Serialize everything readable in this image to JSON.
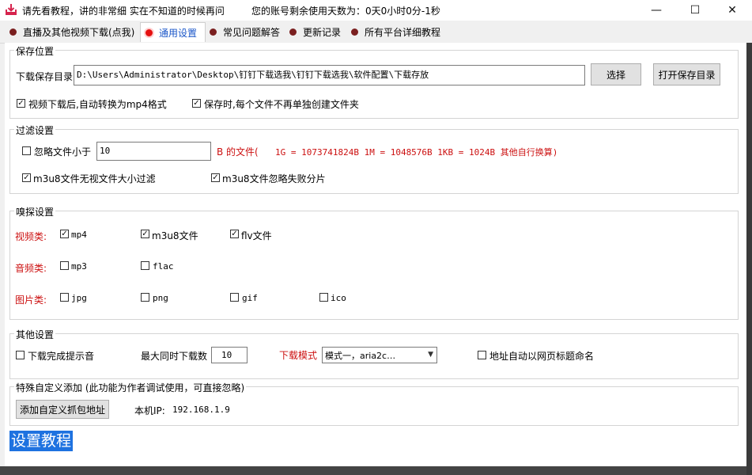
{
  "title": {
    "text": "请先看教程，讲的非常细  实在不知道的时候再问",
    "days_text": "您的账号剩余使用天数为：0天0小时0分-1秒"
  },
  "window_controls": {
    "minimize": "—",
    "maximize": "☐",
    "close": "✕"
  },
  "tabs": [
    {
      "label": "直播及其他视频下载(点我)",
      "active": false
    },
    {
      "label": "通用设置",
      "active": true
    },
    {
      "label": "常见问题解答",
      "active": false
    },
    {
      "label": "更新记录",
      "active": false
    },
    {
      "label": "所有平台详细教程",
      "active": false
    }
  ],
  "save": {
    "group_label": "保存位置",
    "dir_label": "下载保存目录",
    "dir_value": "D:\\Users\\Administrator\\Desktop\\钉钉下载选我\\钉钉下载选我\\软件配置\\下载存放",
    "choose_button": "选择",
    "open_button": "打开保存目录",
    "convert_mp4": {
      "label": "视频下载后,自动转换为mp4格式",
      "checked": true
    },
    "no_folder": {
      "label": "保存时,每个文件不再单独创建文件夹",
      "checked": true
    }
  },
  "filter": {
    "group_label": "过滤设置",
    "ignore_small": {
      "label": "忽略文件小于",
      "checked": false
    },
    "size_value": "10",
    "unit_text": "B 的文件(",
    "conversion_text": "1G = 1073741824B    1M = 1048576B  1KB = 1024B   其他自行换算)",
    "m3u8_no_size": {
      "label": "m3u8文件无视文件大小过滤",
      "checked": true
    },
    "m3u8_ignore_fail": {
      "label": "m3u8文件忽略失败分片",
      "checked": true
    }
  },
  "sniff": {
    "group_label": "嗅探设置",
    "video": {
      "label": "视频类:",
      "items": [
        {
          "label": "mp4",
          "checked": true
        },
        {
          "label": "m3u8文件",
          "checked": true
        },
        {
          "label": "flv文件",
          "checked": true
        }
      ]
    },
    "audio": {
      "label": "音频类:",
      "items": [
        {
          "label": "mp3",
          "checked": false
        },
        {
          "label": "flac",
          "checked": false
        }
      ]
    },
    "image": {
      "label": "图片类:",
      "items": [
        {
          "label": "jpg",
          "checked": false
        },
        {
          "label": "png",
          "checked": false
        },
        {
          "label": "gif",
          "checked": false
        },
        {
          "label": "ico",
          "checked": false
        }
      ]
    }
  },
  "other": {
    "group_label": "其他设置",
    "sound": {
      "label": "下载完成提示音",
      "checked": false
    },
    "max_label": "最大同时下载数",
    "max_value": "10",
    "mode_label": "下载模式",
    "mode_value": "模式一，aria2c…",
    "auto_name": {
      "label": "地址自动以网页标题命名",
      "checked": false
    }
  },
  "custom": {
    "group_label": "特殊自定义添加 (此功能为作者调试使用，可直接忽略)",
    "add_button": "添加自定义抓包地址",
    "ip_label": "本机IP:",
    "ip_value": "192.168.1.9"
  },
  "help_badge": "设置教程",
  "check_glyph": "✓"
}
